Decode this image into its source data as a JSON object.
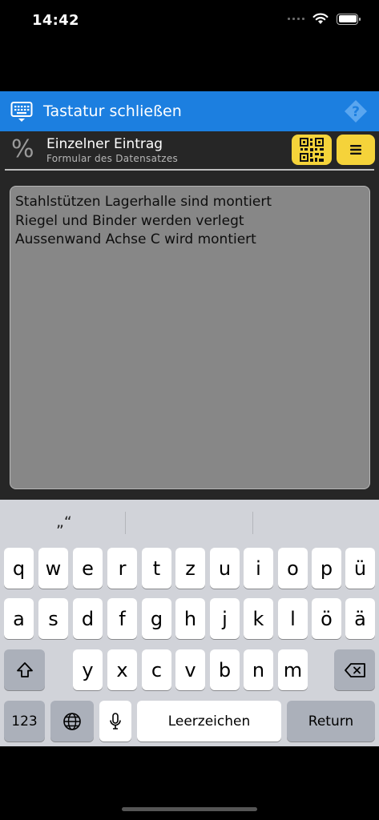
{
  "status_bar": {
    "time": "14:42"
  },
  "appbar": {
    "title": "Tastatur schließen",
    "color": "#1c7fe0"
  },
  "record_header": {
    "icon_glyph": "%",
    "title": "Einzelner Eintrag",
    "subtitle": "Formular des Datensatzes",
    "button_color": "#f5d33a"
  },
  "textarea": {
    "lines": [
      "Stahlstützen Lagerhalle sind montiert",
      "Riegel und Binder werden verlegt",
      "Aussenwand Achse C wird montiert"
    ]
  },
  "keyboard": {
    "suggestions": [
      "„“",
      "",
      ""
    ],
    "row1": [
      "q",
      "w",
      "e",
      "r",
      "t",
      "z",
      "u",
      "i",
      "o",
      "p",
      "ü"
    ],
    "row2": [
      "a",
      "s",
      "d",
      "f",
      "g",
      "h",
      "j",
      "k",
      "l",
      "ö",
      "ä"
    ],
    "row3": [
      "y",
      "x",
      "c",
      "v",
      "b",
      "n",
      "m"
    ],
    "numbers_label": "123",
    "space_label": "Leerzeichen",
    "return_label": "Return"
  }
}
